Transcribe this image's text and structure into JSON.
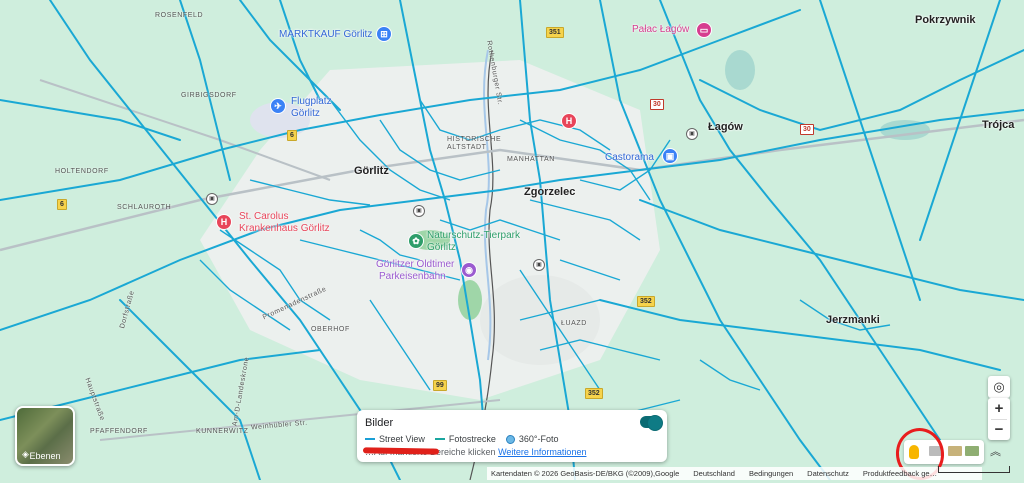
{
  "map": {
    "cities": [
      "Görlitz",
      "Zgorzelec",
      "Jerzmanki",
      "Łagów",
      "Pokrzywnik",
      "Trójca"
    ],
    "districts": [
      "ROSENFELD",
      "GIRBIGSDORF",
      "HOLTENDORF",
      "SCHLAUROTH",
      "HISTORISCHE ALTSTADT",
      "MANHATTAN",
      "OBERHOF",
      "ŁUAZD",
      "KUNNERWITZ",
      "PFAFFENDORF"
    ],
    "streets": [
      "Rothenburger Str.",
      "Promenadenstraße",
      "Dorfstraße",
      "Am-D-Landeskrone",
      "Hauptstraße",
      "Weinhübler Str."
    ],
    "poi_markt": "MARKTKAUF Görlitz",
    "poi_airport_1": "Flugplatz",
    "poi_airport_2": "Görlitz",
    "poi_palace": "Pałac Łagów",
    "poi_castorama": "Castorama",
    "poi_hospital_1": "St. Carolus",
    "poi_hospital_2": "Krankenhaus Görlitz",
    "poi_zoo_1": "Naturschutz-Tierpark",
    "poi_zoo_2": "Görlitz",
    "poi_rail_1": "Görlitzer Oldtimer",
    "poi_rail_2": "Parkeisenbahn",
    "road_shields": [
      "351",
      "30",
      "30",
      "6",
      "6",
      "352",
      "99",
      "352"
    ]
  },
  "layers": {
    "label": "Ebenen"
  },
  "panel": {
    "title": "Bilder",
    "legend_street_view": "Street View",
    "legend_photo_route": "Fotostrecke",
    "legend_360": "360°-Foto",
    "hint": "…Auf markierte Bereiche klicken",
    "hint_link": "Weitere Informationen"
  },
  "controls": {
    "zoom_in": "+",
    "zoom_out": "−"
  },
  "footer": {
    "attribution": "Kartendaten © 2026 GeoBasis-DE/BKG (©2009),Google",
    "country": "Deutschland",
    "terms": "Bedingungen",
    "privacy": "Datenschutz",
    "feedback": "Produktfeedback ge…"
  },
  "colors": {
    "street_view_lines": "#1aa8d4",
    "map_bg": "#cfeedd",
    "annotation": "#e81d1d"
  }
}
